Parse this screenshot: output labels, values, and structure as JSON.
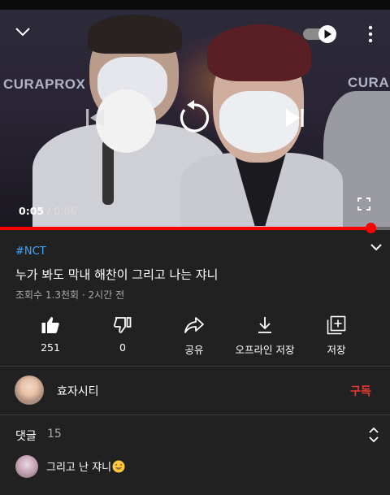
{
  "player": {
    "current_time": "0:05",
    "separator": "/",
    "duration": "0:06",
    "progress": 0.95,
    "brand_left": "CURAPROX",
    "brand_right": "CURAPROX",
    "autoplay_on": true,
    "accent": "#ff0000"
  },
  "video": {
    "hashtag": "#NCT",
    "title": "누가 봐도 막내 해찬이 그리고 나는 쟈니",
    "meta": "조회수 1.3천회 · 2시간 전"
  },
  "actions": [
    {
      "icon": "thumb-up-icon",
      "label": "251"
    },
    {
      "icon": "thumb-down-icon",
      "label": "0"
    },
    {
      "icon": "share-icon",
      "label": "공유"
    },
    {
      "icon": "download-icon",
      "label": "오프라인 저장"
    },
    {
      "icon": "add-to-playlist-icon",
      "label": "저장"
    }
  ],
  "channel": {
    "name": "효자시티",
    "subscribe_label": "구독",
    "subscribe_color": "#e53935"
  },
  "comments": {
    "label": "댓글",
    "count": "15",
    "first_comment": "그리고 난 쟈니"
  }
}
